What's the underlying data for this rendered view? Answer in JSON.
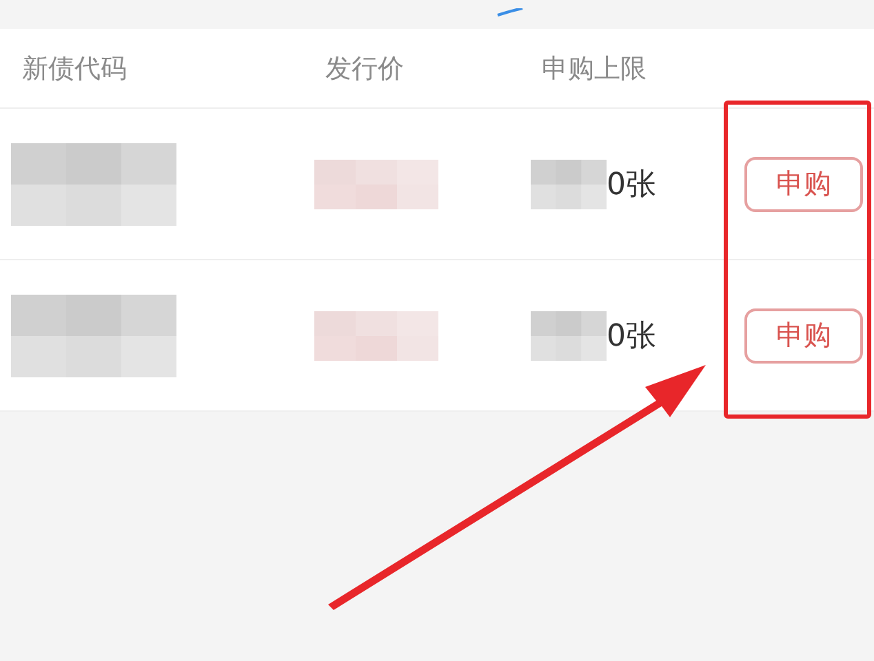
{
  "columns": [
    "新债代码",
    "发行价",
    "申购上限"
  ],
  "rows": [
    {
      "limit": "0张",
      "action": "申购"
    },
    {
      "limit": "0张",
      "action": "申购"
    }
  ]
}
